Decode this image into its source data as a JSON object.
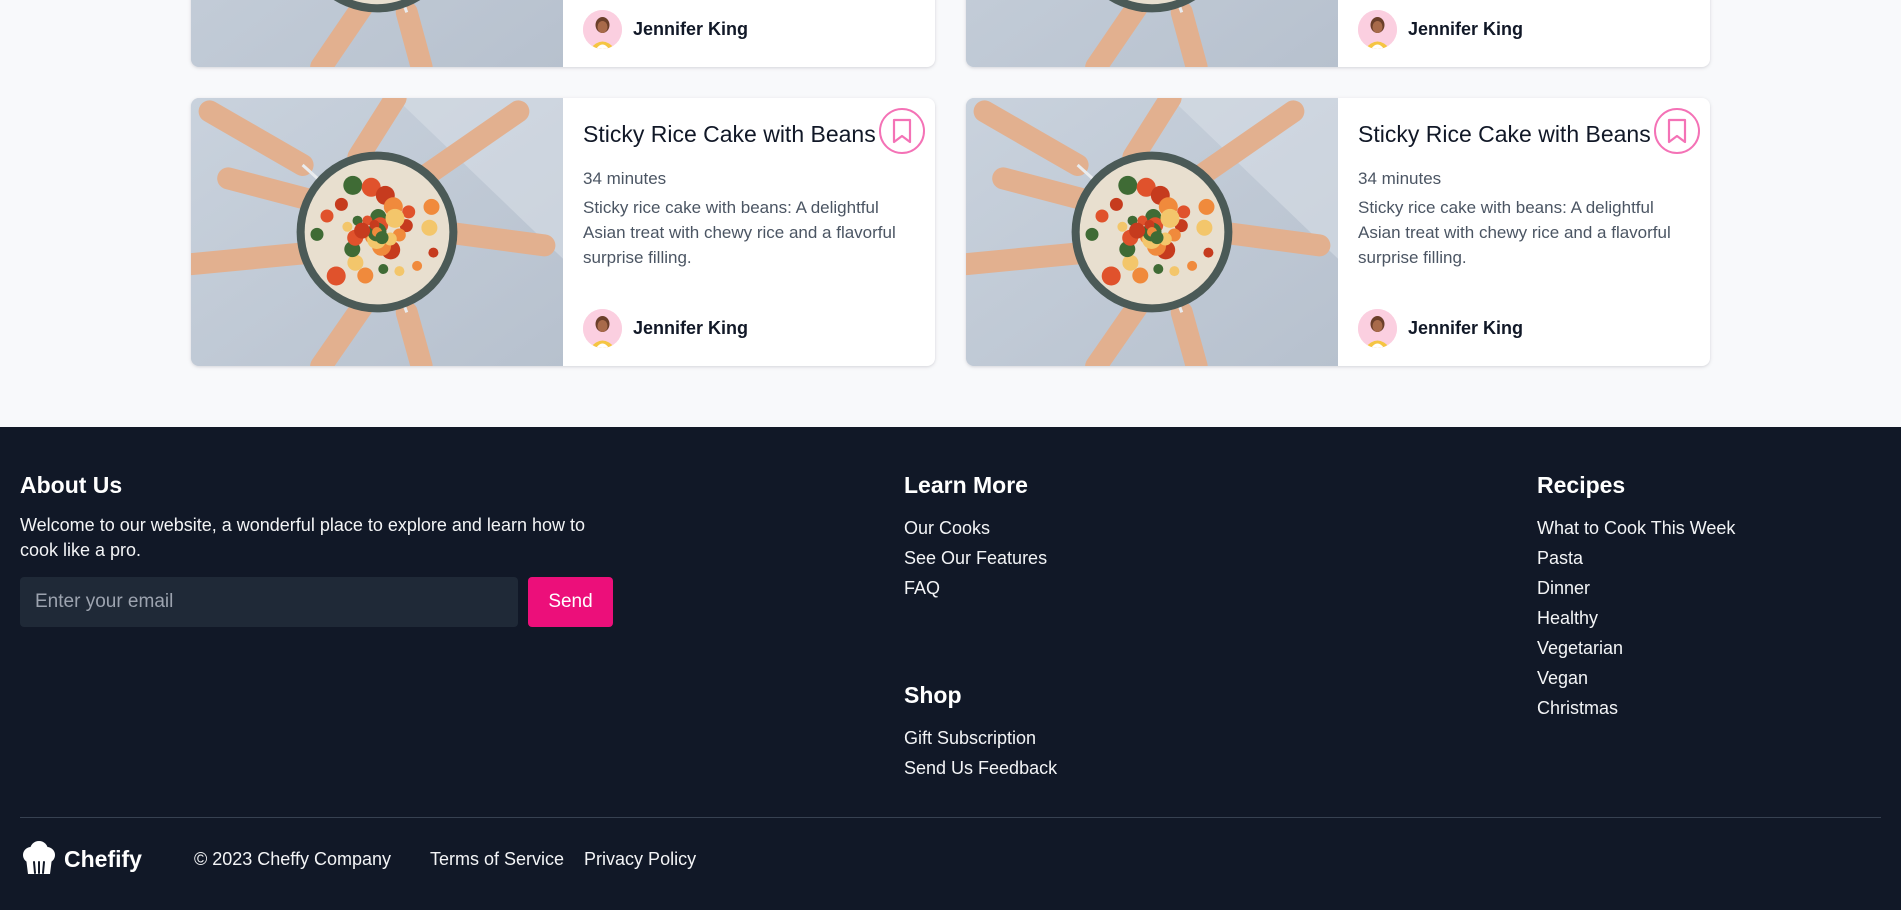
{
  "recipes": [
    {
      "title": "",
      "time": "",
      "description": "",
      "author": "Jennifer King"
    },
    {
      "title": "",
      "time": "",
      "description": "",
      "author": "Jennifer King"
    },
    {
      "title": "Sticky Rice Cake with Beans",
      "time": "34 minutes",
      "description": "Sticky rice cake with beans: A delightful Asian treat with chewy rice and a flavorful surprise filling.",
      "author": "Jennifer King"
    },
    {
      "title": "Sticky Rice Cake with Beans",
      "time": "34 minutes",
      "description": "Sticky rice cake with beans: A delightful Asian treat with chewy rice and a flavorful surprise filling.",
      "author": "Jennifer King"
    }
  ],
  "footer": {
    "about": {
      "heading": "About Us",
      "text": "Welcome to our website, a wonderful place to explore and learn how to cook like a pro.",
      "email_placeholder": "Enter your email",
      "send_label": "Send"
    },
    "learn_more": {
      "heading": "Learn More",
      "links": [
        "Our Cooks",
        "See Our Features",
        "FAQ"
      ]
    },
    "shop": {
      "heading": "Shop",
      "links": [
        "Gift Subscription",
        "Send Us Feedback"
      ]
    },
    "recipes": {
      "heading": "Recipes",
      "links": [
        "What to Cook This Week",
        "Pasta",
        "Dinner",
        "Healthy",
        "Vegetarian",
        "Vegan",
        "Christmas"
      ]
    },
    "brand": "Chefify",
    "copyright": "© 2023 Cheffy Company",
    "legal": [
      "Terms of Service",
      "Privacy Policy"
    ]
  },
  "colors": {
    "accent": "#ec0f7a",
    "bookmark": "#f472b6",
    "footer_bg": "#111827",
    "page_bg": "#f8f9fb"
  },
  "icons": {
    "bookmark": "bookmark-icon",
    "logo": "chef-hat-icon"
  }
}
